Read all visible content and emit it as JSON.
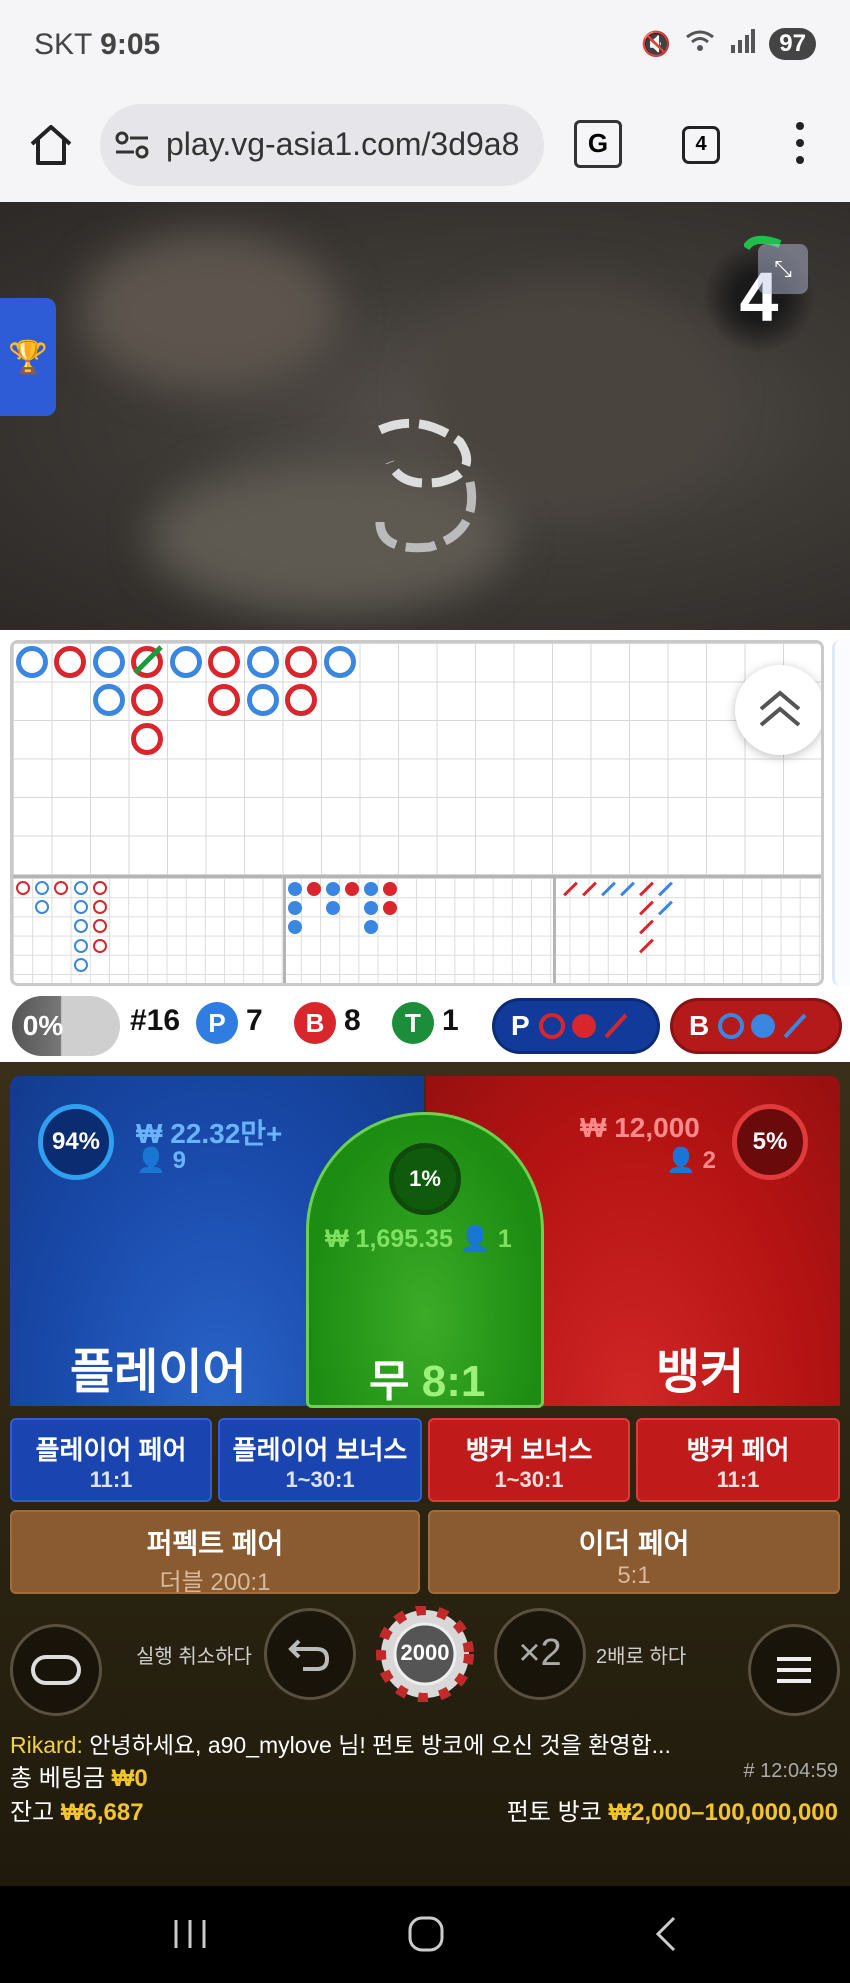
{
  "status_bar": {
    "carrier": "SKT",
    "time": "9:05",
    "battery": "97"
  },
  "browser": {
    "url": "play.vg-asia1.com/3d9a8",
    "tab_count": "4"
  },
  "video": {
    "countdown": "4"
  },
  "stats": {
    "progress_label": "0%",
    "round": "#16",
    "player_label": "P",
    "player_count": "7",
    "banker_label": "B",
    "banker_count": "8",
    "tie_label": "T",
    "tie_count": "1",
    "player_ask": "P",
    "banker_ask": "B"
  },
  "bets": {
    "player": {
      "name": "플레이어",
      "percent": "94%",
      "amount": "₩ 22.32만+",
      "players": "9"
    },
    "tie": {
      "name": "무",
      "odds": "8:1",
      "percent": "1%",
      "amount": "₩ 1,695.35",
      "players": "1"
    },
    "banker": {
      "name": "뱅커",
      "percent": "5%",
      "amount": "₩ 12,000",
      "players": "2"
    },
    "side": [
      {
        "title": "플레이어 페어",
        "odds": "11:1"
      },
      {
        "title": "플레이어 보너스",
        "odds": "1~30:1"
      },
      {
        "title": "뱅커 보너스",
        "odds": "1~30:1"
      },
      {
        "title": "뱅커 페어",
        "odds": "11:1"
      }
    ],
    "perfect_pair": {
      "title": "퍼펙트 페어",
      "odds": "더블 200:1"
    },
    "either_pair": {
      "title": "이더 페어",
      "odds": "5:1"
    }
  },
  "controls": {
    "undo_label": "실행 취소하다",
    "chip_value": "2000",
    "double_symbol": "×2",
    "double_label": "2배로 하다"
  },
  "footer": {
    "chat_user": "Rikard:",
    "chat_message": "안녕하세요, a90_mylove 님! 펀토 방코에 오신 것을 환영합...",
    "total_bet_label": "총 베팅금",
    "total_bet_value": "₩0",
    "round_id": "# 12:04:59",
    "balance_label": "잔고",
    "balance_value": "₩6,687",
    "table_label": "펀토 방코",
    "table_limits": "₩2,000–100,000,000"
  },
  "colors": {
    "player_blue": "#1848a8",
    "banker_red": "#b51313",
    "tie_green": "#1c8d12",
    "gold": "#f2c52e"
  }
}
